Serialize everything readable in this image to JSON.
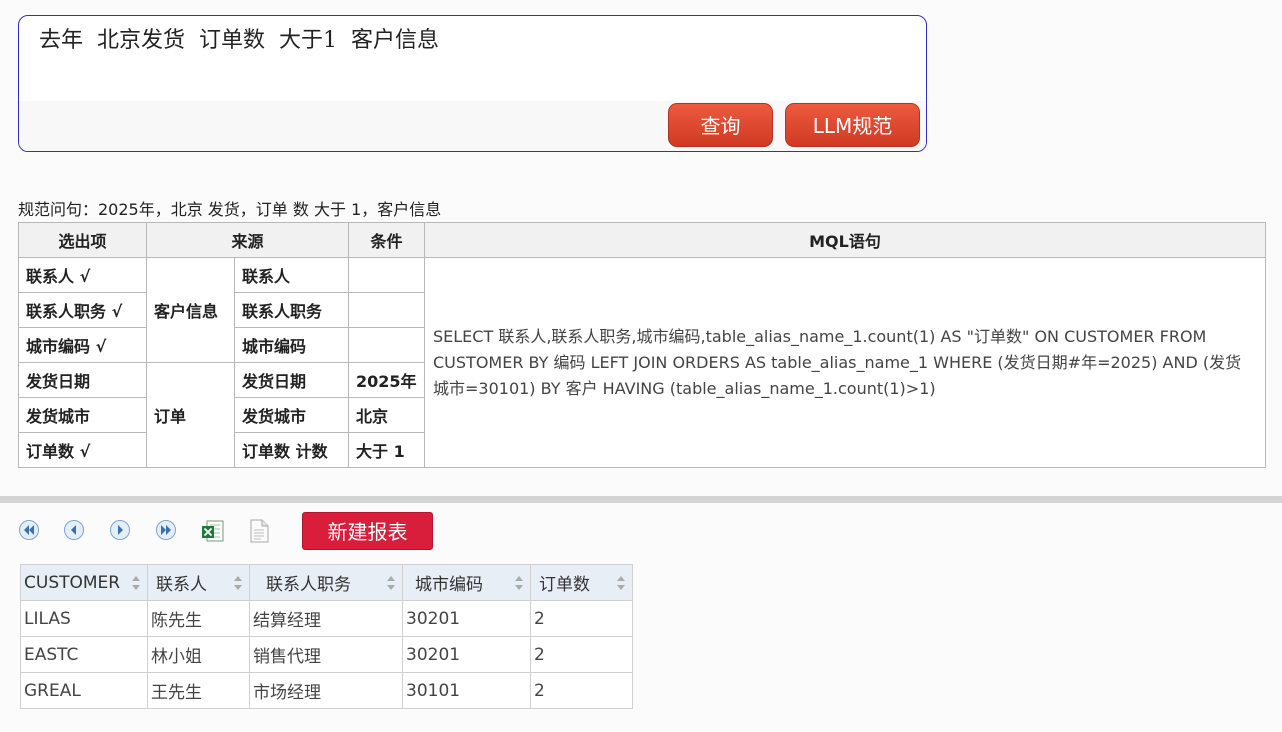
{
  "query": {
    "text": "去年  北京发货  订单数  大于1  客户信息",
    "search_label": "查询",
    "llm_label": "LLM规范"
  },
  "normalized_question": "规范问句：2025年，北京 发货，订单 数 大于 1，客户信息",
  "analysis": {
    "headers": [
      "选出项",
      "来源",
      "条件",
      "MQL语句"
    ],
    "rows": [
      {
        "select": "联系人 √",
        "source": "联系人",
        "condition": ""
      },
      {
        "select": "联系人职务 √",
        "source": "联系人职务",
        "condition": ""
      },
      {
        "select": "城市编码 √",
        "source": "城市编码",
        "condition": ""
      },
      {
        "select": "发货日期",
        "source": "发货日期",
        "condition": "2025年"
      },
      {
        "select": "发货城市",
        "source": "发货城市",
        "condition": "北京"
      },
      {
        "select": "订单数 √",
        "source": "订单数 计数",
        "condition": "大于 1"
      }
    ],
    "groups": [
      "客户信息",
      "订单"
    ],
    "mql": "SELECT 联系人,联系人职务,城市编码,table_alias_name_1.count(1) AS \"订单数\" ON CUSTOMER FROM CUSTOMER BY 编码 LEFT JOIN ORDERS AS table_alias_name_1 WHERE (发货日期#年=2025) AND (发货城市=30101) BY 客户 HAVING (table_alias_name_1.count(1)>1)"
  },
  "toolbar": {
    "icons": [
      "first-page-icon",
      "prev-page-icon",
      "next-page-icon",
      "last-page-icon",
      "excel-export-icon",
      "document-icon"
    ],
    "new_report_label": "新建报表"
  },
  "results": {
    "columns": [
      "CUSTOMER",
      "联系人",
      "联系人职务",
      "城市编码",
      "订单数"
    ],
    "rows": [
      [
        "LILAS",
        "陈先生",
        "结算经理",
        "30201",
        "2"
      ],
      [
        "EASTC",
        "林小姐",
        "销售代理",
        "30201",
        "2"
      ],
      [
        "GREAL",
        "王先生",
        "市场经理",
        "30101",
        "2"
      ]
    ]
  },
  "colors": {
    "query_border": "#2e2ecc",
    "button_red": "#d03a23",
    "new_report_red": "#d81e3a",
    "results_header_bg": "#e8eef6"
  }
}
